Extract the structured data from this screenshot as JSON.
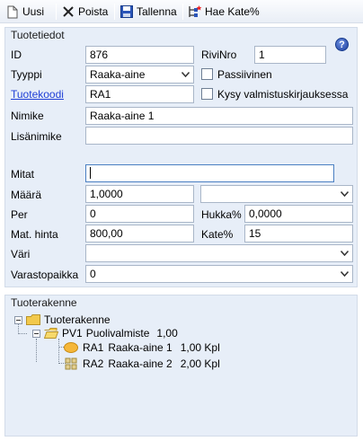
{
  "toolbar": {
    "new_label": "Uusi",
    "delete_label": "Poista",
    "save_label": "Tallenna",
    "get_margin_label": "Hae Kate%"
  },
  "product_info": {
    "title": "Tuotetiedot",
    "id_label": "ID",
    "id_value": "876",
    "rivinro_label": "RiviNro",
    "rivinro_value": "1",
    "type_label": "Tyyppi",
    "type_value": "Raaka-aine",
    "inactive_label": "Passiivinen",
    "code_label": "Tuotekoodi",
    "code_value": "RA1",
    "ask_label": "Kysy valmistuskirjauksessa",
    "name_label": "Nimike",
    "name_value": "Raaka-aine 1",
    "extra_name_label": "Lisänimike",
    "extra_name_value": "",
    "dims_label": "Mitat",
    "dims_value": "",
    "qty_label": "Määrä",
    "qty_value": "1,0000",
    "unit_value": "",
    "per_label": "Per",
    "per_value": "0",
    "waste_label": "Hukka%",
    "waste_value": "0,0000",
    "price_label": "Mat. hinta",
    "price_value": "800,00",
    "margin_label": "Kate%",
    "margin_value": "15",
    "color_label": "Väri",
    "color_value": "",
    "storage_label": "Varastopaikka",
    "storage_value": "0"
  },
  "structure": {
    "title": "Tuoterakenne",
    "root_label": "Tuoterakenne",
    "child_code": "PV1",
    "child_name": "Puolivalmiste",
    "child_qty": "1,00",
    "leaves": [
      {
        "code": "RA1",
        "name": "Raaka-aine 1",
        "qty": "1,00 Kpl"
      },
      {
        "code": "RA2",
        "name": "Raaka-aine 2",
        "qty": "2,00 Kpl"
      }
    ]
  },
  "colors": {
    "panel_bg": "#e7eef8",
    "link": "#1f3fd6",
    "accent": "#1f3f9e"
  }
}
